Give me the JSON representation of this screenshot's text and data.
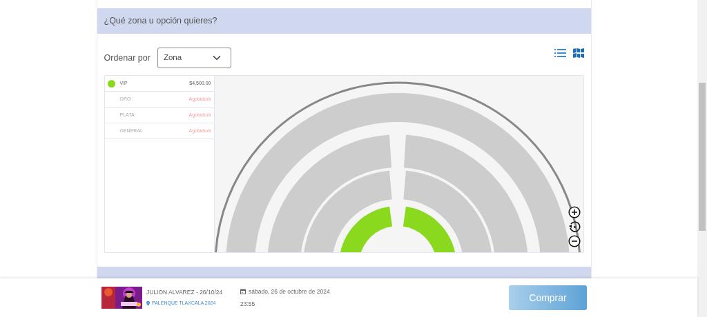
{
  "section_header": "¿Qué zona u opción quieres?",
  "sort": {
    "label": "Ordenar por",
    "value": "Zona"
  },
  "zones": [
    {
      "name": "VIP",
      "available": true,
      "status": "$4,500.00"
    },
    {
      "name": "ORO",
      "available": false,
      "status": "Agotado/a"
    },
    {
      "name": "PLATA",
      "available": false,
      "status": "Agotado/a"
    },
    {
      "name": "GENERAL",
      "available": false,
      "status": "Agotado/a"
    }
  ],
  "event": {
    "title": "JULION ALVAREZ - 26/10/24",
    "venue": "PALENQUE TLAXCALA 2024",
    "date": "sábado, 26 de octubre de 2024",
    "time": "23:55"
  },
  "buy_button": "Comprar"
}
